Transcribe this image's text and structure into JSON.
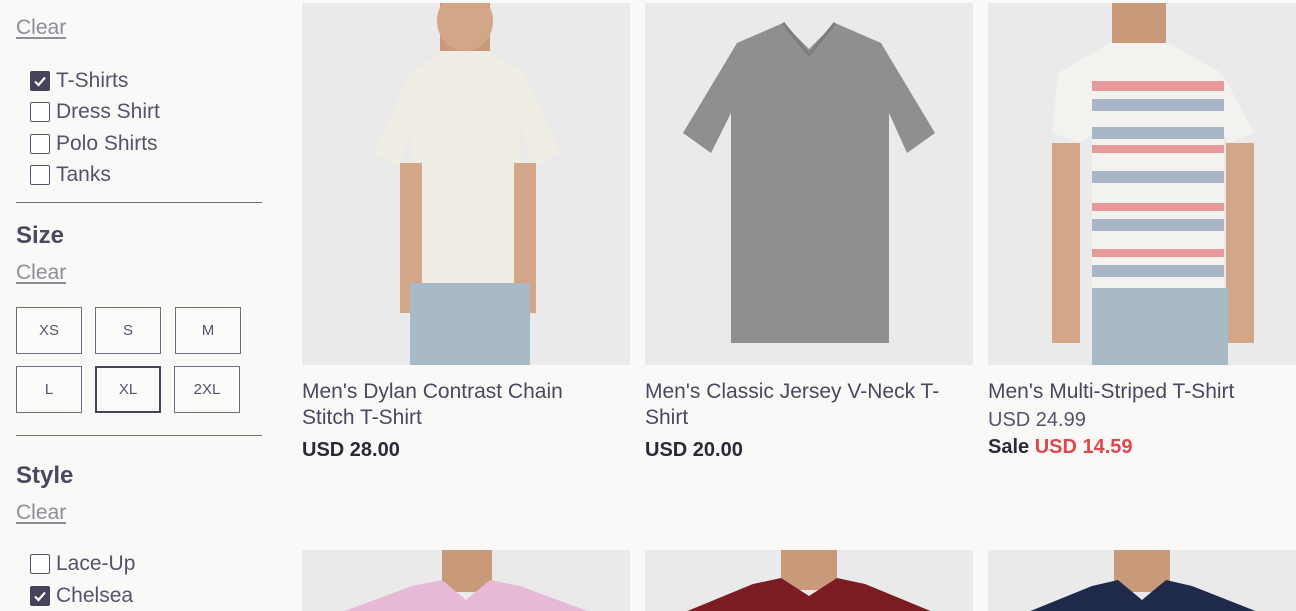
{
  "filters": {
    "category": {
      "clear_label": "Clear",
      "options": [
        {
          "label": "T-Shirts",
          "checked": true
        },
        {
          "label": "Dress Shirt",
          "checked": false
        },
        {
          "label": "Polo Shirts",
          "checked": false
        },
        {
          "label": "Tanks",
          "checked": false
        }
      ]
    },
    "size": {
      "title": "Size",
      "clear_label": "Clear",
      "options": [
        {
          "label": "XS",
          "selected": false
        },
        {
          "label": "S",
          "selected": false
        },
        {
          "label": "M",
          "selected": false
        },
        {
          "label": "L",
          "selected": false
        },
        {
          "label": "XL",
          "selected": true
        },
        {
          "label": "2XL",
          "selected": false
        }
      ]
    },
    "style": {
      "title": "Style",
      "clear_label": "Clear",
      "options": [
        {
          "label": "Lace-Up",
          "checked": false
        },
        {
          "label": "Chelsea",
          "checked": true
        }
      ]
    }
  },
  "products": [
    {
      "name": "Men's Dylan Contrast Chain Stitch T-Shirt",
      "price": "USD 28.00",
      "shirt_color": "#efede4"
    },
    {
      "name": "Men's Classic Jersey V-Neck T-Shirt",
      "price": "USD 20.00",
      "shirt_color": "#8f8f8f"
    },
    {
      "name": "Men's Multi-Striped T-Shirt",
      "original_price": "USD 24.99",
      "sale_label": "Sale",
      "sale_price": "USD 14.59",
      "shirt_color": "#f4f2ef"
    }
  ],
  "next_row": [
    {
      "shirt_color": "#e8b9d6"
    },
    {
      "shirt_color": "#7a1c22"
    },
    {
      "shirt_color": "#1f2a4a"
    }
  ],
  "colors": {
    "sale": "#e0474c",
    "text": "#3c3c54",
    "image_bg": "#ebeaea"
  }
}
